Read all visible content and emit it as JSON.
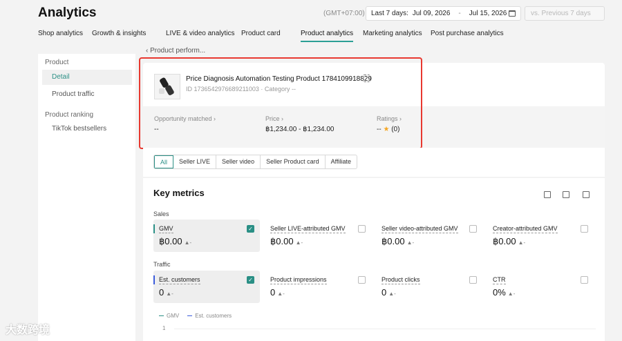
{
  "header": {
    "title": "Analytics",
    "timezone": "(GMT+07:00)",
    "date_range_label": "Last 7 days:",
    "date_start": "Jul 09, 2026",
    "date_sep": "-",
    "date_end": "Jul 15, 2026",
    "compare_placeholder": "vs. Previous 7 days"
  },
  "tabs": [
    {
      "label": "Shop analytics"
    },
    {
      "label": "Growth & insights"
    },
    {
      "label": "LIVE & video analytics"
    },
    {
      "label": "Product card"
    },
    {
      "label": "Product analytics",
      "active": true
    },
    {
      "label": "Marketing analytics"
    },
    {
      "label": "Post purchase analytics"
    }
  ],
  "sidebar": {
    "section1": "Product",
    "item_detail": "Detail",
    "item_traffic": "Product traffic",
    "section2": "Product ranking",
    "item_bestsellers": "TikTok bestsellers"
  },
  "breadcrumb": "‹ Product perform...",
  "product": {
    "name": "Price Diagnosis Automation Testing Product 1784109918829",
    "meta": "ID 1736542976689211003  ·  Category --",
    "opportunity_label": "Opportunity matched ›",
    "opportunity_value": "--",
    "price_label": "Price ›",
    "price_value": "฿1,234.00 - ฿1,234.00",
    "ratings_label": "Ratings ›",
    "ratings_value": "-- ",
    "ratings_star": "★",
    "ratings_count": " (0)"
  },
  "filters": [
    "All",
    "Seller LIVE",
    "Seller video",
    "Seller Product card",
    "Affiliate"
  ],
  "metrics": {
    "title": "Key metrics",
    "sales_label": "Sales",
    "traffic_label": "Traffic",
    "sales": [
      {
        "name": "GMV",
        "value": "฿0.00",
        "trend": "▲-",
        "checked": true
      },
      {
        "name": "Seller LIVE-attributed GMV",
        "value": "฿0.00",
        "trend": "▲-",
        "checked": false
      },
      {
        "name": "Seller video-attributed GMV",
        "value": "฿0.00",
        "trend": "▲-",
        "checked": false
      },
      {
        "name": "Creator-attributed GMV",
        "value": "฿0.00",
        "trend": "▲-",
        "checked": false
      }
    ],
    "traffic": [
      {
        "name": "Est. customers",
        "value": "0",
        "trend": "▲-",
        "checked": true
      },
      {
        "name": "Product impressions",
        "value": "0",
        "trend": "▲-",
        "checked": false
      },
      {
        "name": "Product clicks",
        "value": "0",
        "trend": "▲-",
        "checked": false
      },
      {
        "name": "CTR",
        "value": "0%",
        "trend": "▲-",
        "checked": false
      }
    ],
    "legend_gmv": "GMV",
    "legend_customers": "Est. customers",
    "y_tick": "1",
    "check_mark": "✓"
  },
  "colors": {
    "accent": "#2a8f85",
    "highlight": "#e8382f",
    "gmv": "#2a8f85",
    "customers": "#3b5bdb"
  },
  "watermark": "大数跨境"
}
